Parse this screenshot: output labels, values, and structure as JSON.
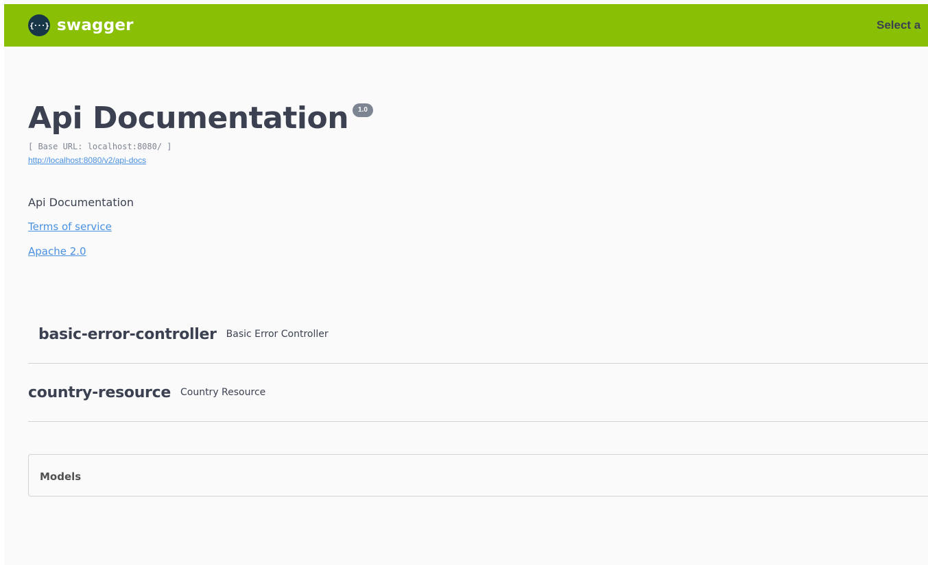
{
  "topbar": {
    "logo_icon": "{···}",
    "logo_text": "swagger",
    "select_label": "Select a"
  },
  "info": {
    "title": "Api Documentation",
    "version": "1.0",
    "base_url": "[ Base URL: localhost:8080/ ]",
    "spec_url": "http://localhost:8080/v2/api-docs",
    "description": "Api Documentation",
    "terms_of_service": "Terms of service",
    "license": "Apache 2.0"
  },
  "tags": [
    {
      "name": "basic-error-controller",
      "description": "Basic Error Controller"
    },
    {
      "name": "country-resource",
      "description": "Country Resource"
    }
  ],
  "models": {
    "title": "Models"
  },
  "colors": {
    "topbar": "#89bf04",
    "link": "#4990e2",
    "text": "#3b4151",
    "version_badge": "#7d8492"
  }
}
